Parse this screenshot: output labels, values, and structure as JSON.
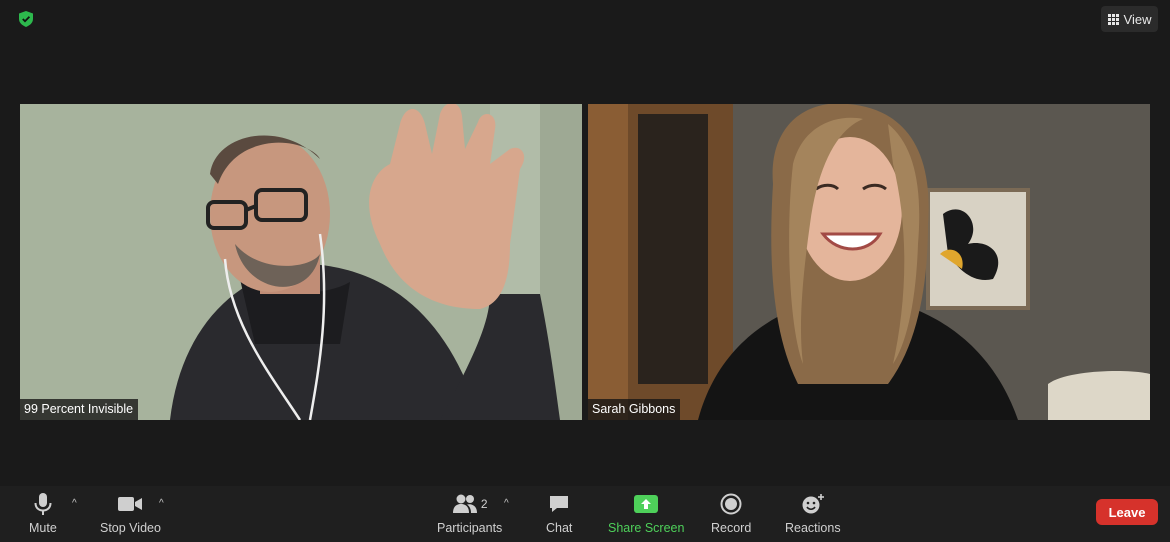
{
  "topbar": {
    "view_label": "View",
    "security_icon": "shield-check-icon"
  },
  "participants": [
    {
      "name": "99 Percent Invisible"
    },
    {
      "name": "Sarah Gibbons"
    }
  ],
  "toolbar": {
    "mute": "Mute",
    "stop_video": "Stop Video",
    "participants": "Participants",
    "participants_count": "2",
    "chat": "Chat",
    "share_screen": "Share Screen",
    "record": "Record",
    "reactions": "Reactions",
    "leave": "Leave"
  },
  "colors": {
    "share_green": "#4ed05a",
    "leave_red": "#d6322b",
    "shield_green": "#2db84d"
  }
}
